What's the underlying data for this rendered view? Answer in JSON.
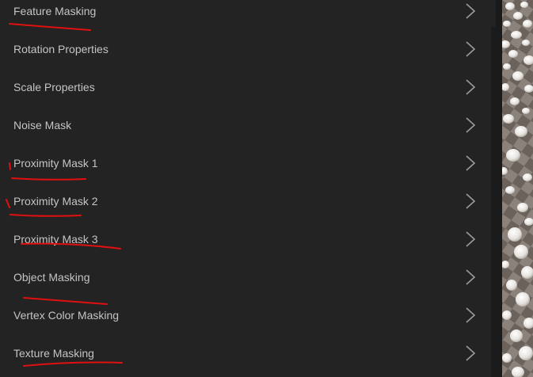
{
  "panel": {
    "items": [
      {
        "label": "Feature Masking"
      },
      {
        "label": "Rotation Properties"
      },
      {
        "label": "Scale Properties"
      },
      {
        "label": "Noise Mask"
      },
      {
        "label": "Proximity Mask 1"
      },
      {
        "label": "Proximity Mask 2"
      },
      {
        "label": "Proximity Mask 3"
      },
      {
        "label": "Object Masking"
      },
      {
        "label": "Vertex Color Masking"
      },
      {
        "label": "Texture Masking"
      }
    ],
    "chevron_icon": "chevron-right-icon"
  },
  "annotations": {
    "color": "#e01010"
  },
  "viewport": {
    "content": "3d-scatter-preview"
  }
}
